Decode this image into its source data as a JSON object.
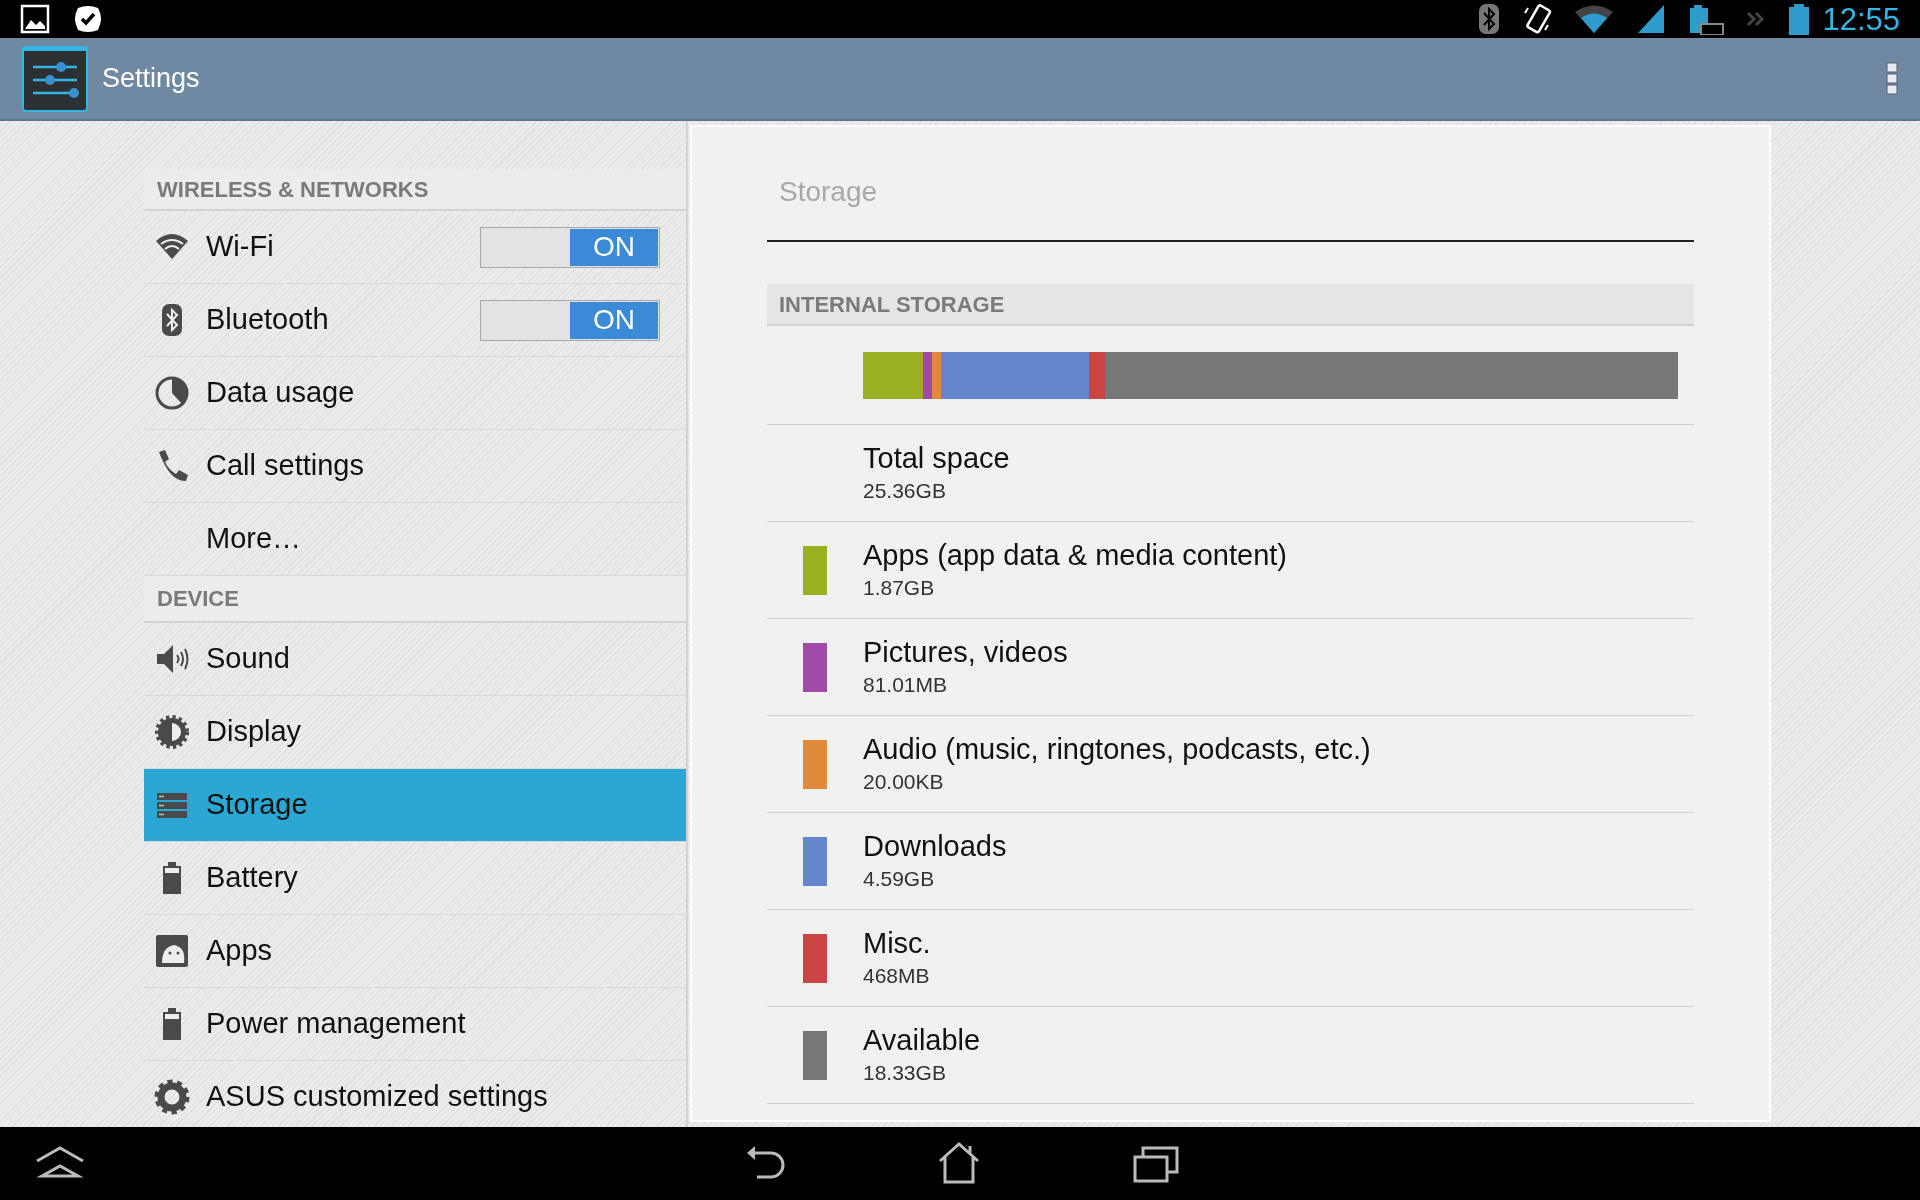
{
  "status_bar": {
    "time": "12:55"
  },
  "action_bar": {
    "title": "Settings"
  },
  "sidebar": {
    "sections": [
      {
        "header": "WIRELESS & NETWORKS",
        "items": [
          {
            "label": "Wi-Fi",
            "kind": "toggle",
            "toggle": {
              "label": "ON",
              "on": true
            },
            "selected": false
          },
          {
            "label": "Bluetooth",
            "kind": "toggle",
            "toggle": {
              "label": "ON",
              "on": true
            },
            "selected": false
          },
          {
            "label": "Data usage",
            "kind": "link",
            "selected": false
          },
          {
            "label": "Call settings",
            "kind": "link",
            "selected": false
          },
          {
            "label": "More…",
            "kind": "link",
            "selected": false
          }
        ]
      },
      {
        "header": "DEVICE",
        "items": [
          {
            "label": "Sound",
            "kind": "link",
            "selected": false
          },
          {
            "label": "Display",
            "kind": "link",
            "selected": false
          },
          {
            "label": "Storage",
            "kind": "link",
            "selected": true
          },
          {
            "label": "Battery",
            "kind": "link",
            "selected": false
          },
          {
            "label": "Apps",
            "kind": "link",
            "selected": false
          },
          {
            "label": "Power management",
            "kind": "link",
            "selected": false
          },
          {
            "label": "ASUS customized settings",
            "kind": "link",
            "selected": false
          }
        ]
      }
    ]
  },
  "storage": {
    "title": "Storage",
    "section_header": "INTERNAL STORAGE",
    "rows": [
      {
        "kind": "total",
        "label": "Total space",
        "value": "25.36GB"
      },
      {
        "kind": "category",
        "label": "Apps (app data & media content)",
        "value": "1.87GB",
        "color": "#9aaf22"
      },
      {
        "kind": "category",
        "label": "Pictures, videos",
        "value": "81.01MB",
        "color": "#a04aa8"
      },
      {
        "kind": "category",
        "label": "Audio (music, ringtones, podcasts, etc.)",
        "value": "20.00KB",
        "color": "#e0893a"
      },
      {
        "kind": "category",
        "label": "Downloads",
        "value": "4.59GB",
        "color": "#6386cc"
      },
      {
        "kind": "category",
        "label": "Misc.",
        "value": "468MB",
        "color": "#c94444"
      },
      {
        "kind": "category",
        "label": "Available",
        "value": "18.33GB",
        "color": "#777777"
      }
    ]
  }
}
